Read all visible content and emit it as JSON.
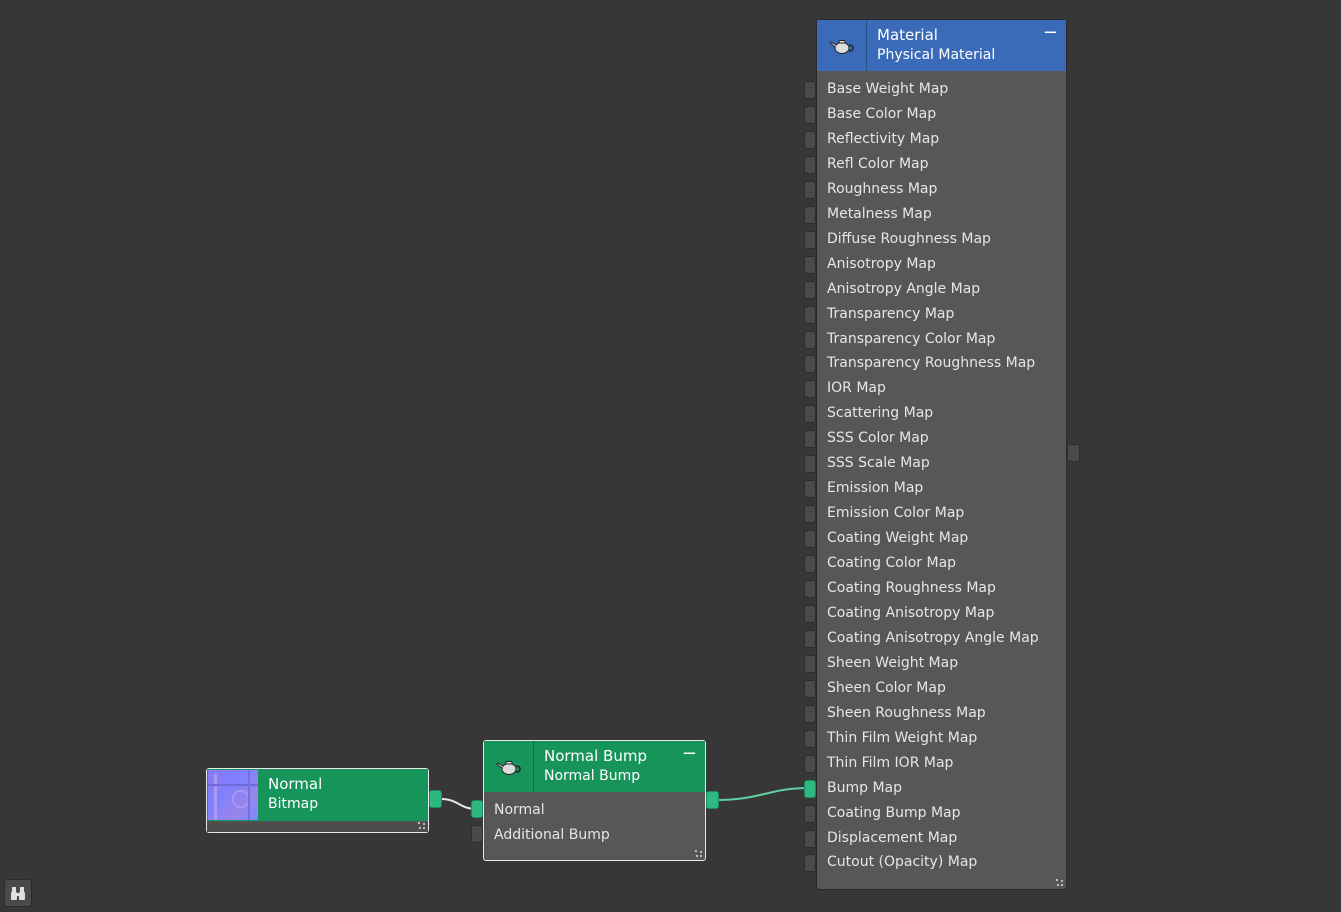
{
  "colors": {
    "canvas": "#373737",
    "node_body": "#575757",
    "material_header": "#3a6bb8",
    "map_header": "#17945a",
    "connected_socket": "#2fb780",
    "wire": "#e9e9e9",
    "wire_active": "#5fd0a0"
  },
  "nodes": {
    "bitmap": {
      "title": "Normal",
      "subtitle": "Bitmap",
      "thumbnail_icon": "normal-map-thumbnail"
    },
    "normal_bump": {
      "title": "Normal Bump",
      "subtitle": "Normal Bump",
      "header_icon": "teapot-icon",
      "minimize": "−",
      "inputs": [
        "Normal",
        "Additional Bump"
      ]
    },
    "material": {
      "title": "Material",
      "subtitle": "Physical Material",
      "header_icon": "teapot-icon",
      "minimize": "−",
      "inputs": [
        "Base Weight Map",
        "Base Color Map",
        "Reflectivity Map",
        "Refl Color Map",
        "Roughness Map",
        "Metalness Map",
        "Diffuse Roughness Map",
        "Anisotropy Map",
        "Anisotropy Angle Map",
        "Transparency Map",
        "Transparency Color Map",
        "Transparency Roughness Map",
        "IOR Map",
        "Scattering Map",
        "SSS Color Map",
        "SSS Scale Map",
        "Emission Map",
        "Emission Color Map",
        "Coating Weight Map",
        "Coating Color Map",
        "Coating Roughness Map",
        "Coating Anisotropy Map",
        "Coating Anisotropy Angle Map",
        "Sheen Weight Map",
        "Sheen Color Map",
        "Sheen Roughness Map",
        "Thin Film Weight Map",
        "Thin Film IOR Map",
        "Bump Map",
        "Coating Bump Map",
        "Displacement Map",
        "Cutout (Opacity) Map"
      ],
      "connected_input": "Bump Map"
    }
  },
  "toolbar": {
    "navigator_icon": "binoculars-icon"
  }
}
